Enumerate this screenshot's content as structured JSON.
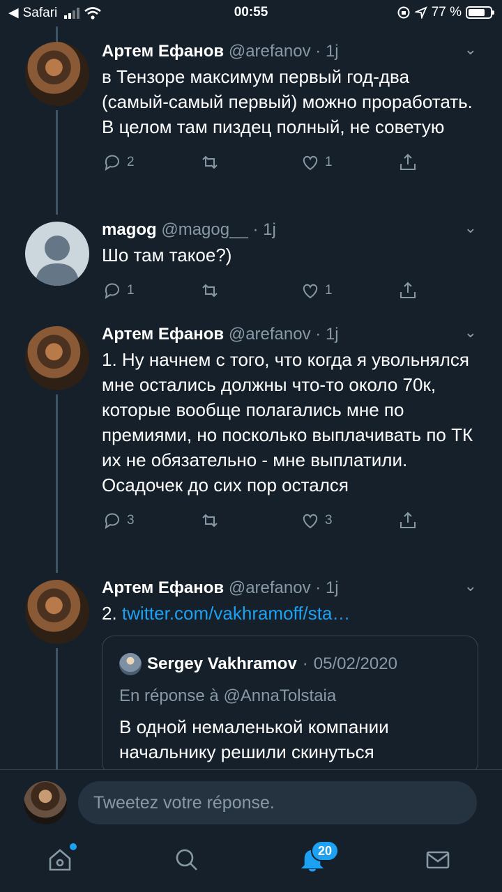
{
  "status_bar": {
    "back_app": "Safari",
    "time": "00:55",
    "battery": "77 %",
    "battery_level": 0.77
  },
  "tweets": [
    {
      "name": "Артем Ефанов",
      "handle": "@arefanov",
      "time": "1j",
      "text": "в Тензоре максимум первый год-два (самый-самый первый) можно проработать. В целом там пиздец полный, не советую",
      "replies": "2",
      "likes": "1"
    },
    {
      "name": "magog",
      "handle": "@magog__",
      "time": "1j",
      "text": "Шо там такое?)",
      "replies": "1",
      "likes": "1"
    },
    {
      "name": "Артем Ефанов",
      "handle": "@arefanov",
      "time": "1j",
      "text": "1. Ну начнем с того, что когда я увольнялся мне остались должны что-то около 70к, которые вообще полагались мне по премиями, но посколько выплачивать по ТК их не обязательно - мне выплатили. Осадочек до сих пор остался",
      "replies": "3",
      "likes": "3"
    },
    {
      "name": "Артем Ефанов",
      "handle": "@arefanov",
      "time": "1j",
      "text_prefix": "2.",
      "link": "twitter.com/vakhramoff/sta…"
    }
  ],
  "quote": {
    "name": "Sergey Vakhramov",
    "date": "05/02/2020",
    "reply_to": "En réponse à @AnnaTolstaia",
    "text": "В одной немаленькой компании начальнику решили скинуться"
  },
  "reply": {
    "placeholder": "Tweetez votre réponse."
  },
  "tabs": {
    "notifications_badge": "20"
  },
  "icons": [
    "back-arrow-icon",
    "wifi-icon",
    "orientation-lock-icon",
    "location-icon",
    "battery-icon",
    "reply-icon",
    "retweet-icon",
    "like-icon",
    "share-icon",
    "chevron-down-icon",
    "home-icon",
    "search-icon",
    "bell-icon",
    "mail-icon"
  ],
  "colors": {
    "background": "#15202b",
    "accent": "#1da1f2",
    "muted": "#8899a6",
    "border": "#38444d"
  }
}
